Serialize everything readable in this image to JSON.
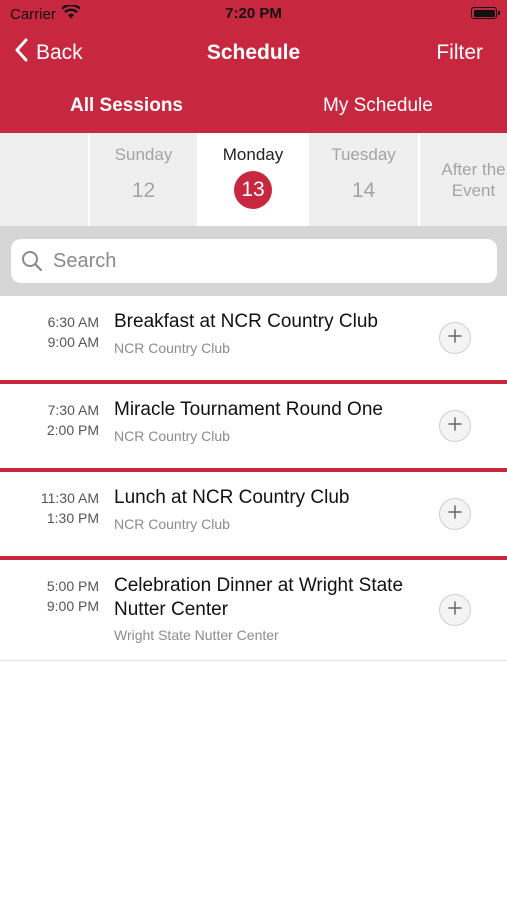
{
  "status_bar": {
    "carrier": "Carrier",
    "time": "7:20 PM"
  },
  "nav": {
    "back_label": "Back",
    "title": "Schedule",
    "filter_label": "Filter"
  },
  "segments": {
    "all_sessions": "All Sessions",
    "my_schedule": "My Schedule"
  },
  "days": [
    {
      "name": "Sunday",
      "number": "12"
    },
    {
      "name": "Monday",
      "number": "13",
      "selected": true
    },
    {
      "name": "Tuesday",
      "number": "14"
    },
    {
      "name": "After the Event",
      "name_line1": "After the",
      "name_line2": "Event"
    }
  ],
  "search": {
    "placeholder": "Search",
    "value": ""
  },
  "sessions": [
    {
      "start": "6:30 AM",
      "end": "9:00 AM",
      "title": "Breakfast at NCR Country Club",
      "venue": "NCR Country Club"
    },
    {
      "start": "7:30 AM",
      "end": "2:00 PM",
      "title": "Miracle Tournament Round One",
      "venue": "NCR Country Club"
    },
    {
      "start": "11:30 AM",
      "end": "1:30 PM",
      "title": "Lunch at NCR Country Club",
      "venue": "NCR Country Club"
    },
    {
      "start": "5:00 PM",
      "end": "9:00 PM",
      "title": "Celebration Dinner at Wright State Nutter Center",
      "venue": "Wright State Nutter Center"
    }
  ],
  "colors": {
    "brand": "#C8283F",
    "divider": "#C8283F"
  },
  "icons": [
    "wifi-icon",
    "battery-icon",
    "back-chevron-icon",
    "search-icon",
    "plus-icon"
  ]
}
